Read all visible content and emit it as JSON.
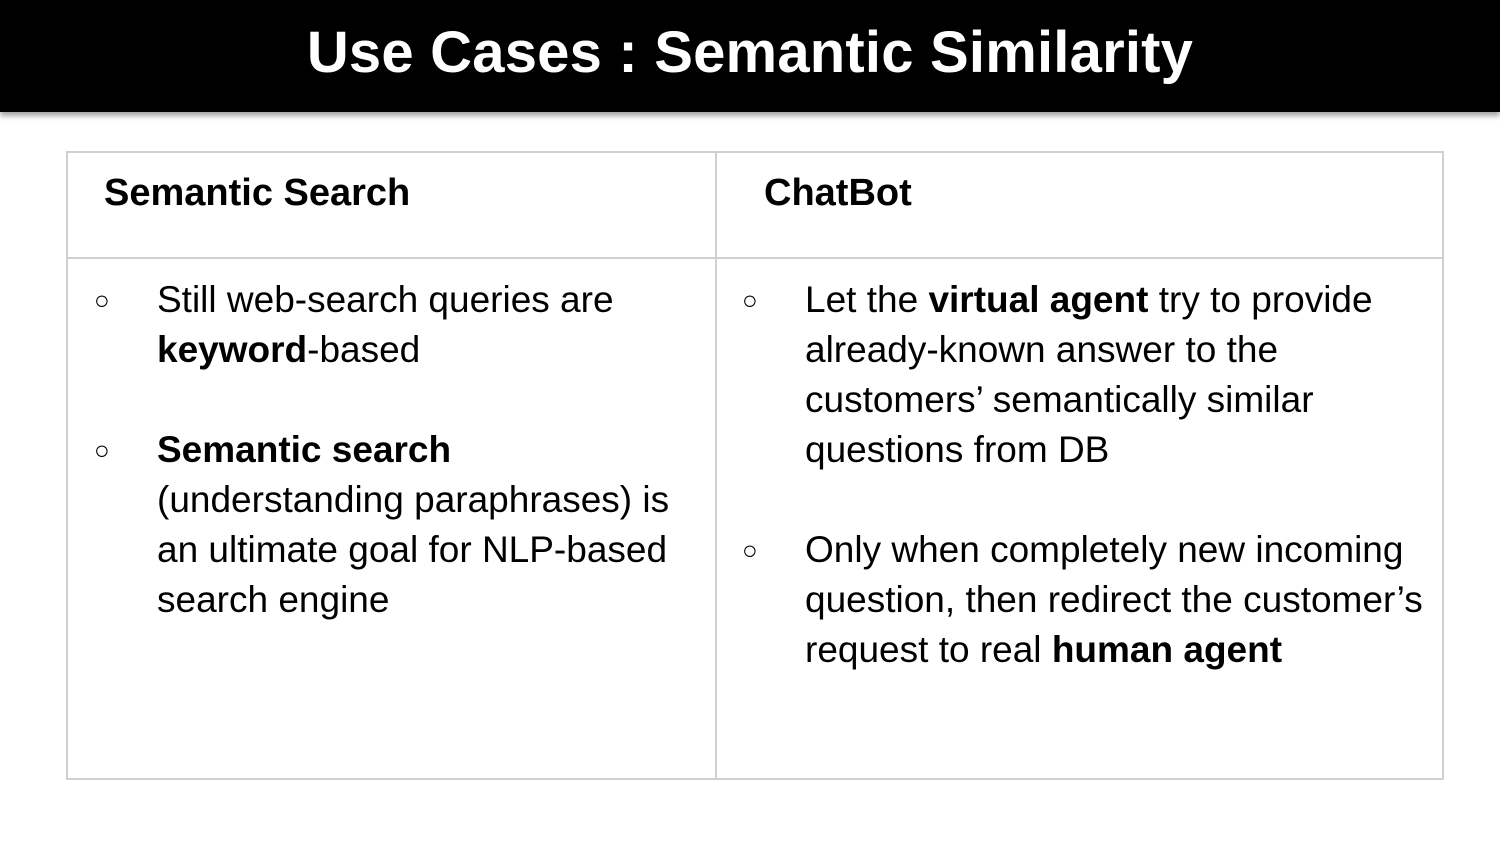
{
  "slide": {
    "title": "Use Cases : Semantic Similarity",
    "bullet_glyph": "○",
    "columns": [
      {
        "header": "Semantic Search",
        "bullets": [
          {
            "parts": [
              {
                "text": "Still web-search queries are ",
                "bold": false
              },
              {
                "text": "keyword",
                "bold": true
              },
              {
                "text": "-based",
                "bold": false
              }
            ]
          },
          {
            "parts": [
              {
                "text": "Semantic search",
                "bold": true
              },
              {
                "text": " (understanding paraphrases) is an ultimate goal for NLP-based search engine",
                "bold": false
              }
            ]
          }
        ]
      },
      {
        "header": "ChatBot",
        "bullets": [
          {
            "parts": [
              {
                "text": "Let the ",
                "bold": false
              },
              {
                "text": "virtual agent",
                "bold": true
              },
              {
                "text": " try to provide already-known answer to the customers’ semantically similar questions from DB",
                "bold": false
              }
            ]
          },
          {
            "parts": [
              {
                "text": "Only when completely new incoming question, then redirect the customer’s request to real ",
                "bold": false
              },
              {
                "text": "human agent",
                "bold": true
              }
            ]
          }
        ]
      }
    ]
  },
  "colors": {
    "title_bar_bg": "#000000",
    "title_text": "#ffffff",
    "table_border": "#cfcfcf",
    "body_text": "#000000"
  }
}
